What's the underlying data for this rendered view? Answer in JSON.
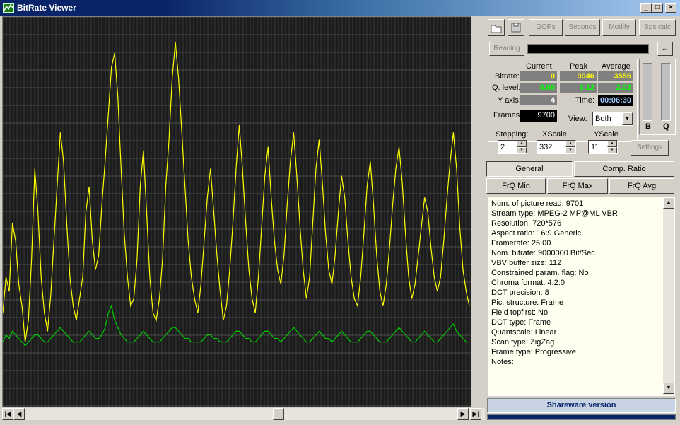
{
  "window": {
    "title": "BitRate Viewer"
  },
  "toolbar": {
    "gops": "GOPs",
    "seconds": "Seconds",
    "modify": "Modify",
    "bps_calc": "Bps calc"
  },
  "reading": {
    "label": "Reading",
    "browse": "..."
  },
  "stats": {
    "col_current": "Current",
    "col_peak": "Peak",
    "col_average": "Average",
    "bitrate_label": "Bitrate:",
    "bitrate_current": "0",
    "bitrate_peak": "9946",
    "bitrate_average": "3556",
    "qlevel_label": "Q. level:",
    "qlevel_current": "0.00",
    "qlevel_peak": "3.12",
    "qlevel_average": "2.02",
    "yaxis_label": "Y axis:",
    "yaxis_value": "4",
    "time_label": "Time:",
    "time_value": "00:06:30",
    "frames_label": "Frames:",
    "frames_value": "9700",
    "view_label": "View:",
    "view_value": "Both"
  },
  "meters": {
    "b_label": "B",
    "q_label": "Q"
  },
  "controls": {
    "stepping_label": "Stepping:",
    "stepping_value": "2",
    "xscale_label": "XScale",
    "xscale_value": "332",
    "yscale_label": "YScale",
    "yscale_value": "11",
    "settings": "Settings"
  },
  "tabs": {
    "general": "General",
    "comp_ratio": "Comp. Ratio",
    "frq_min": "FrQ Min",
    "frq_max": "FrQ Max",
    "frq_avg": "FrQ Avg"
  },
  "info_lines": [
    "Num. of picture read: 9701",
    "Stream type: MPEG-2  MP@ML  VBR",
    "Resolution: 720*576",
    "Aspect ratio: 16:9 Generic",
    "Framerate: 25.00",
    "Nom. bitrate: 9000000 Bit/Sec",
    "VBV buffer size: 112",
    "Constrained param. flag: No",
    "Chroma format: 4:2:0",
    "DCT precision: 8",
    "Pic. structure: Frame",
    "Field topfirst: No",
    "DCT type: Frame",
    "Quantscale: Linear",
    "Scan type: ZigZag",
    "Frame type: Progressive",
    "Notes:"
  ],
  "footer": {
    "shareware": "Shareware version"
  },
  "colors": {
    "bitrate_line": "#ffff00",
    "quant_line": "#00cc00",
    "plot_bg": "#1c1c1c",
    "grid": "#808080"
  },
  "chart_data": {
    "type": "line",
    "series": [
      {
        "values": [
          20,
          30,
          26,
          45,
          40,
          28,
          22,
          12,
          18,
          35,
          60,
          48,
          30,
          20,
          15,
          25,
          40,
          55,
          70,
          62,
          45,
          30,
          22,
          18,
          24,
          30,
          48,
          55,
          40,
          32,
          36,
          50,
          62,
          75,
          88,
          92,
          80,
          60,
          42,
          30,
          22,
          24,
          35,
          55,
          65,
          48,
          30,
          20,
          18,
          24,
          35,
          55,
          68,
          85,
          95,
          85,
          70,
          55,
          40,
          30,
          24,
          20,
          28,
          40,
          52,
          60,
          48,
          36,
          26,
          18,
          22,
          32,
          45,
          60,
          72,
          60,
          45,
          32,
          24,
          20,
          30,
          44,
          58,
          66,
          52,
          40,
          32,
          28,
          36,
          50,
          62,
          70,
          58,
          44,
          32,
          24,
          30,
          45,
          60,
          68,
          56,
          42,
          32,
          28,
          36,
          48,
          58,
          52,
          40,
          30,
          24,
          22,
          30,
          42,
          55,
          62,
          50,
          36,
          26,
          22,
          28,
          38,
          50,
          60,
          66,
          56,
          42,
          30,
          24,
          28,
          36,
          44,
          52,
          48,
          38,
          30,
          26,
          30,
          40,
          52,
          62,
          70,
          60,
          44,
          32,
          26,
          22
        ]
      },
      {
        "values": [
          12,
          14,
          13,
          15,
          14,
          13,
          12,
          11,
          12,
          13,
          14,
          14,
          13,
          12,
          12,
          13,
          14,
          15,
          16,
          15,
          14,
          13,
          12,
          12,
          12,
          13,
          14,
          15,
          14,
          13,
          13,
          14,
          16,
          20,
          22,
          18,
          16,
          14,
          13,
          12,
          12,
          12,
          13,
          14,
          15,
          14,
          13,
          12,
          12,
          12,
          13,
          14,
          15,
          16,
          16,
          15,
          14,
          13,
          13,
          12,
          12,
          12,
          12,
          13,
          14,
          14,
          13,
          13,
          12,
          12,
          12,
          13,
          14,
          15,
          15,
          14,
          13,
          13,
          12,
          12,
          13,
          14,
          15,
          15,
          14,
          13,
          13,
          12,
          13,
          14,
          15,
          16,
          15,
          14,
          13,
          12,
          12,
          13,
          14,
          15,
          14,
          13,
          13,
          12,
          13,
          14,
          15,
          14,
          13,
          12,
          12,
          12,
          13,
          14,
          15,
          15,
          14,
          13,
          12,
          12,
          12,
          13,
          14,
          15,
          16,
          15,
          14,
          13,
          12,
          12,
          13,
          14,
          15,
          14,
          13,
          12,
          12,
          13,
          14,
          15,
          16,
          17,
          15,
          14,
          13,
          12,
          12
        ]
      }
    ]
  }
}
